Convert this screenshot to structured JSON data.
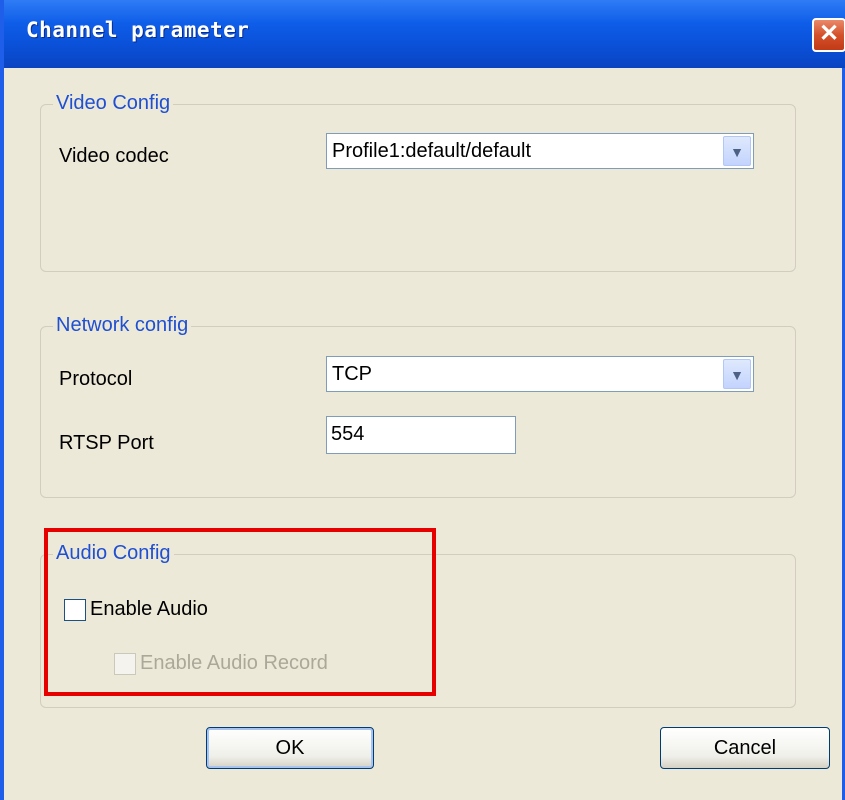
{
  "window": {
    "title": "Channel parameter",
    "close_symbol": "✕"
  },
  "video_config": {
    "legend": "Video Config",
    "codec_label": "Video codec",
    "codec_value": "Profile1:default/default"
  },
  "network_config": {
    "legend": "Network config",
    "protocol_label": "Protocol",
    "protocol_value": "TCP",
    "rtsp_port_label": "RTSP Port",
    "rtsp_port_value": "554"
  },
  "audio_config": {
    "legend": "Audio Config",
    "enable_audio_label": "Enable Audio",
    "enable_audio_checked": false,
    "enable_record_label": "Enable Audio Record",
    "enable_record_checked": false,
    "enable_record_disabled": true
  },
  "buttons": {
    "ok_label": "OK",
    "cancel_label": "Cancel"
  },
  "colors": {
    "title_bar": "#0a4fd6",
    "group_legend": "#1f4fd2",
    "highlight": "#e60000",
    "dialog_bg": "#ece9d8"
  },
  "icons": {
    "dropdown": "chevron-down-icon",
    "close": "close-icon"
  }
}
